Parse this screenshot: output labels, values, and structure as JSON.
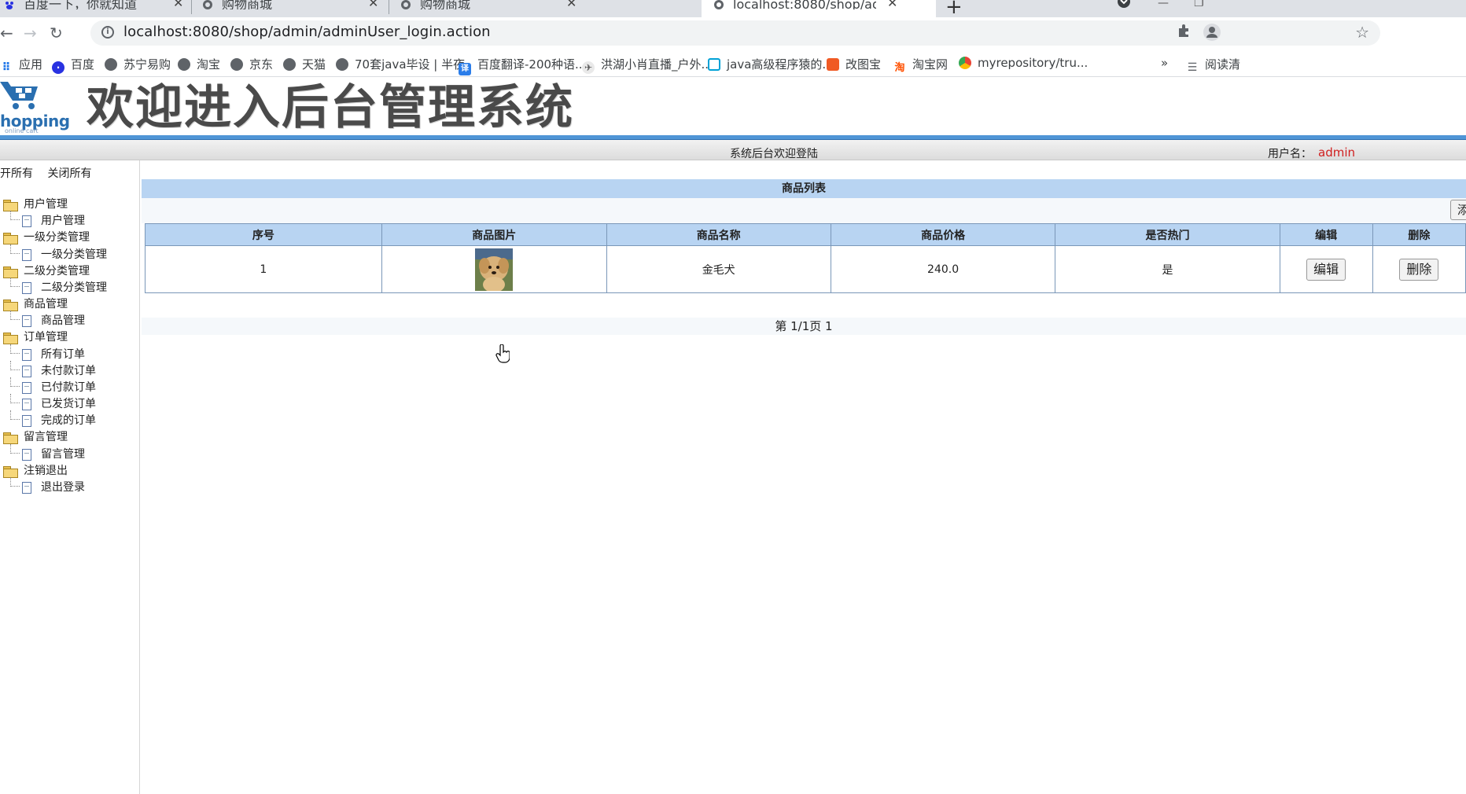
{
  "browser": {
    "tabs": [
      {
        "title": "百度一下，你就知道"
      },
      {
        "title": "购物商城"
      },
      {
        "title": "购物商城"
      },
      {
        "title": "localhost:8080/shop/admin/ac"
      }
    ],
    "url": "localhost:8080/shop/admin/adminUser_login.action",
    "bookmarks": [
      {
        "label": "应用",
        "icon": "apps-icon"
      },
      {
        "label": "百度",
        "icon": "baidu-icon"
      },
      {
        "label": "苏宁易购",
        "icon": "globe-icon"
      },
      {
        "label": "淘宝",
        "icon": "globe-icon"
      },
      {
        "label": "京东",
        "icon": "globe-icon"
      },
      {
        "label": "天猫",
        "icon": "globe-icon"
      },
      {
        "label": "70套java毕设 | 半夜",
        "icon": "globe-icon"
      },
      {
        "label": "百度翻译-200种语...",
        "icon": "translate-icon"
      },
      {
        "label": "洪湖小肖直播_户外...",
        "icon": "bird-icon"
      },
      {
        "label": "java高级程序猿的...",
        "icon": "bilibili-icon"
      },
      {
        "label": "改图宝",
        "icon": "gaitubao-icon"
      },
      {
        "label": "淘宝网",
        "icon": "taobao-icon"
      },
      {
        "label": "myrepository/tru...",
        "icon": "chrome-icon"
      }
    ],
    "reading_list": "阅读清",
    "overflow": "»"
  },
  "header": {
    "logo_text": "hopping",
    "logo_sub": "online cart",
    "banner": "欢迎进入后台管理系统",
    "welcome": "系统后台欢迎登陆",
    "user_label": "用户名：",
    "username": "admin"
  },
  "sidebar": {
    "expand_all": "开所有",
    "collapse_all": "关闭所有",
    "groups": [
      {
        "label": "用户管理",
        "items": [
          "用户管理"
        ]
      },
      {
        "label": "一级分类管理",
        "items": [
          "一级分类管理"
        ]
      },
      {
        "label": "二级分类管理",
        "items": [
          "二级分类管理"
        ]
      },
      {
        "label": "商品管理",
        "items": [
          "商品管理"
        ]
      },
      {
        "label": "订单管理",
        "items": [
          "所有订单",
          "未付款订单",
          "已付款订单",
          "已发货订单",
          "完成的订单"
        ]
      },
      {
        "label": "留言管理",
        "items": [
          "留言管理"
        ]
      },
      {
        "label": "注销退出",
        "items": [
          "退出登录"
        ]
      }
    ]
  },
  "main": {
    "list_title": "商品列表",
    "add_button": "添",
    "columns": [
      "序号",
      "商品图片",
      "商品名称",
      "商品价格",
      "是否热门",
      "编辑",
      "删除"
    ],
    "rows": [
      {
        "index": "1",
        "name": "金毛犬",
        "price": "240.0",
        "hot": "是",
        "edit": "编辑",
        "delete": "删除"
      }
    ],
    "pager": "第 1/1页 1"
  },
  "colors": {
    "header_bar": "#4f95d6",
    "table_header": "#b8d4f2",
    "username": "#d02020"
  }
}
